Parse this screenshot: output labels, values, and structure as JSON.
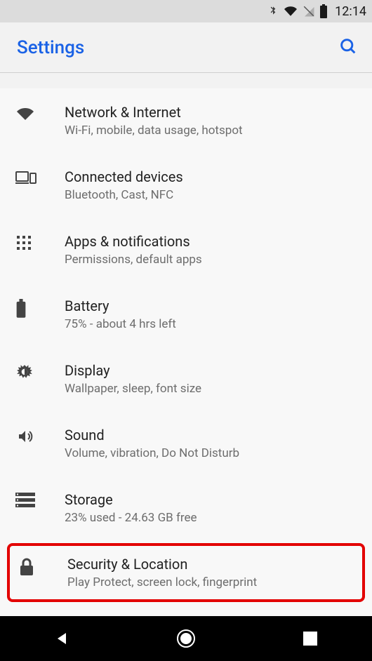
{
  "statusbar": {
    "time": "12:14"
  },
  "appbar": {
    "title": "Settings",
    "search_icon": "search"
  },
  "items": [
    {
      "icon": "wifi",
      "title": "Network & Internet",
      "sub": "Wi-Fi, mobile, data usage, hotspot"
    },
    {
      "icon": "devices",
      "title": "Connected devices",
      "sub": "Bluetooth, Cast, NFC"
    },
    {
      "icon": "apps",
      "title": "Apps & notifications",
      "sub": "Permissions, default apps"
    },
    {
      "icon": "battery",
      "title": "Battery",
      "sub": "75% - about 4 hrs left"
    },
    {
      "icon": "display",
      "title": "Display",
      "sub": "Wallpaper, sleep, font size"
    },
    {
      "icon": "sound",
      "title": "Sound",
      "sub": "Volume, vibration, Do Not Disturb"
    },
    {
      "icon": "storage",
      "title": "Storage",
      "sub": "23% used - 24.63 GB free"
    },
    {
      "icon": "lock",
      "title": "Security & Location",
      "sub": "Play Protect, screen lock, fingerprint",
      "highlight": true
    }
  ]
}
